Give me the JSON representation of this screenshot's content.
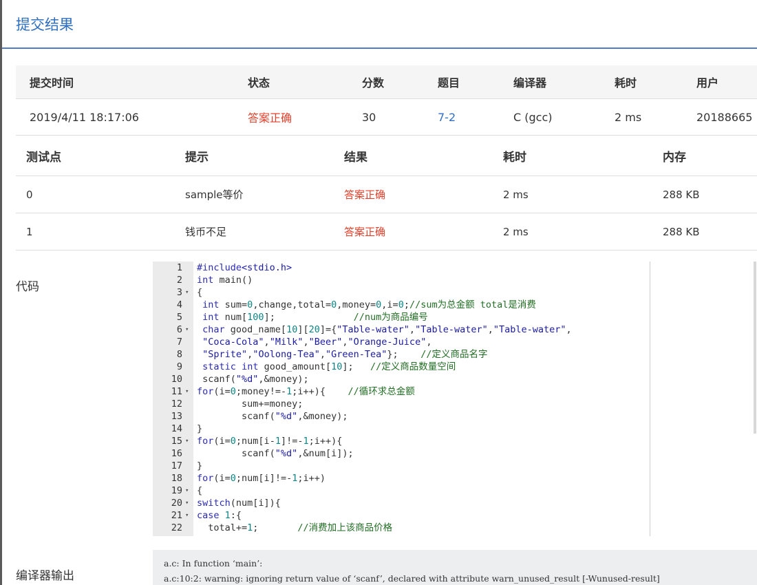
{
  "modal": {
    "title": "提交结果"
  },
  "summary": {
    "headers": [
      "提交时间",
      "状态",
      "分数",
      "题目",
      "编译器",
      "耗时",
      "用户"
    ],
    "row": {
      "time": "2019/4/11 18:17:06",
      "status": "答案正确",
      "score": "30",
      "problem": "7-2",
      "compiler": "C (gcc)",
      "duration": "2 ms",
      "user": "20188665"
    }
  },
  "test_cases": {
    "headers": [
      "测试点",
      "提示",
      "结果",
      "耗时",
      "内存"
    ],
    "rows": [
      {
        "id": "0",
        "hint": "sample等价",
        "result": "答案正确",
        "time": "2 ms",
        "memory": "288 KB"
      },
      {
        "id": "1",
        "hint": "钱币不足",
        "result": "答案正确",
        "time": "2 ms",
        "memory": "288 KB"
      }
    ]
  },
  "code": {
    "label": "代码",
    "lines": [
      {
        "n": "1",
        "text": "#include<stdio.h>"
      },
      {
        "n": "2",
        "text": "int main()"
      },
      {
        "n": "3",
        "text": "{",
        "fold": "▾"
      },
      {
        "n": "4",
        "text": " int sum=0,change,total=0,money=0,i=0;//sum为总金额 total是消费"
      },
      {
        "n": "5",
        "text": " int num[100];              //num为商品编号"
      },
      {
        "n": "6",
        "text": " char good_name[10][20]={\"Table-water\",\"Table-water\",\"Table-water\",",
        "fold": "▾"
      },
      {
        "n": "7",
        "text": " \"Coca-Cola\",\"Milk\",\"Beer\",\"Orange-Juice\","
      },
      {
        "n": "8",
        "text": " \"Sprite\",\"Oolong-Tea\",\"Green-Tea\"};    //定义商品名字"
      },
      {
        "n": "9",
        "text": " static int good_amount[10];   //定义商品数量空间"
      },
      {
        "n": "10",
        "text": " scanf(\"%d\",&money);"
      },
      {
        "n": "11",
        "text": "for(i=0;money!=-1;i++){    //循环求总金额",
        "fold": "▾"
      },
      {
        "n": "12",
        "text": "        sum+=money;"
      },
      {
        "n": "13",
        "text": "        scanf(\"%d\",&money);"
      },
      {
        "n": "14",
        "text": "}"
      },
      {
        "n": "15",
        "text": "for(i=0;num[i-1]!=-1;i++){",
        "fold": "▾"
      },
      {
        "n": "16",
        "text": "        scanf(\"%d\",&num[i]);"
      },
      {
        "n": "17",
        "text": "}"
      },
      {
        "n": "18",
        "text": "for(i=0;num[i]!=-1;i++)"
      },
      {
        "n": "19",
        "text": "{",
        "fold": "▾"
      },
      {
        "n": "20",
        "text": "switch(num[i]){",
        "fold": "▾"
      },
      {
        "n": "21",
        "text": "case 1:{",
        "fold": "▾"
      },
      {
        "n": "22",
        "text": "  total+=1;       //消费加上该商品价格"
      }
    ]
  },
  "compiler_output": {
    "label": "编译器输出",
    "lines": [
      "a.c: In function ‘main’:",
      "a.c:10:2: warning: ignoring return value of ‘scanf’, declared with attribute warn_unused_result [-Wunused-result]"
    ]
  }
}
